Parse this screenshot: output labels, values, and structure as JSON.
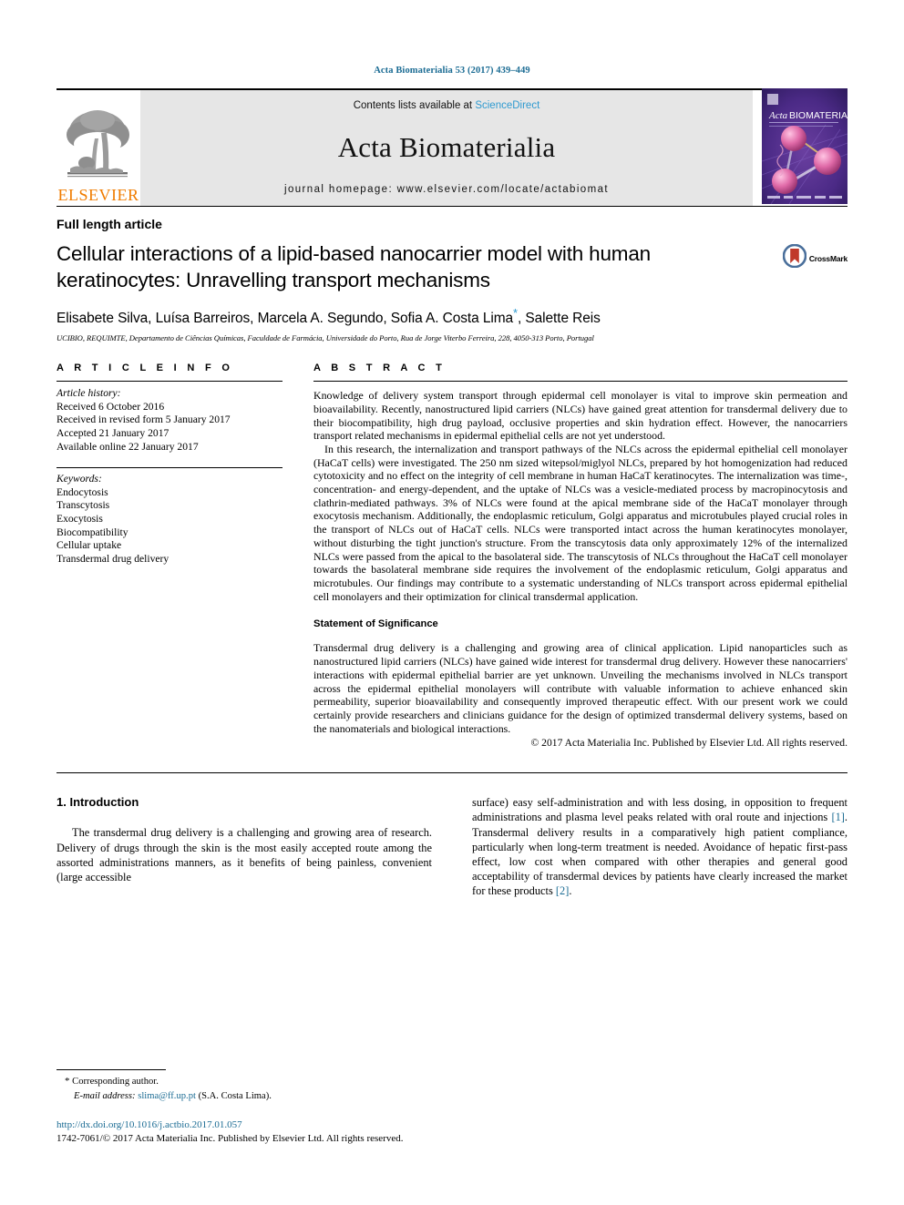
{
  "running_head": "Acta Biomaterialia 53 (2017) 439–449",
  "masthead": {
    "contents_prefix": "Contents lists available at ",
    "sciencedirect": "ScienceDirect",
    "journal_title": "Acta Biomaterialia",
    "homepage": "journal homepage: www.elsevier.com/locate/actabiomat",
    "publisher_wordmark": "ELSEVIER",
    "publisher_logo_icon": "elsevier-tree-icon",
    "cover_icon": "journal-cover-thumbnail",
    "cover_title": "Acta BIOMATERIALIA",
    "colors": {
      "band_bg": "#e6e6e6",
      "link": "#2e9ad0",
      "elsevier_orange": "#f07c00",
      "running_head": "#1a6b93"
    }
  },
  "article": {
    "type": "Full length article",
    "title": "Cellular interactions of a lipid-based nanocarrier model with human keratinocytes: Unravelling transport mechanisms",
    "crossmark": {
      "label": "CrossMark",
      "icon": "crossmark-icon"
    },
    "authors": "Elisabete Silva, Luísa Barreiros, Marcela A. Segundo, Sofia A. Costa Lima",
    "authors_tail": ", Salette Reis",
    "corresponding_marker": "*",
    "affiliation": "UCIBIO, REQUIMTE, Departamento de Ciências Químicas, Faculdade de Farmácia, Universidade do Porto, Rua de Jorge Viterbo Ferreira, 228, 4050-313 Porto, Portugal"
  },
  "article_info": {
    "heading": "A R T I C L E   I N F O",
    "history_label": "Article history:",
    "history": [
      "Received 6 October 2016",
      "Received in revised form 5 January 2017",
      "Accepted 21 January 2017",
      "Available online 22 January 2017"
    ],
    "keywords_label": "Keywords:",
    "keywords": [
      "Endocytosis",
      "Transcytosis",
      "Exocytosis",
      "Biocompatibility",
      "Cellular uptake",
      "Transdermal drug delivery"
    ]
  },
  "abstract": {
    "heading": "A B S T R A C T",
    "paragraphs": [
      "Knowledge of delivery system transport through epidermal cell monolayer is vital to improve skin permeation and bioavailability. Recently, nanostructured lipid carriers (NLCs) have gained great attention for transdermal delivery due to their biocompatibility, high drug payload, occlusive properties and skin hydration effect. However, the nanocarriers transport related mechanisms in epidermal epithelial cells are not yet understood.",
      "In this research, the internalization and transport pathways of the NLCs across the epidermal epithelial cell monolayer (HaCaT cells) were investigated. The 250 nm sized witepsol/miglyol NLCs, prepared by hot homogenization had reduced cytotoxicity and no effect on the integrity of cell membrane in human HaCaT keratinocytes. The internalization was time-, concentration- and energy-dependent, and the uptake of NLCs was a vesicle-mediated process by macropinocytosis and clathrin-mediated pathways. 3% of NLCs were found at the apical membrane side of the HaCaT monolayer through exocytosis mechanism. Additionally, the endoplasmic reticulum, Golgi apparatus and microtubules played crucial roles in the transport of NLCs out of HaCaT cells. NLCs were transported intact across the human keratinocytes monolayer, without disturbing the tight junction's structure. From the transcytosis data only approximately 12% of the internalized NLCs were passed from the apical to the basolateral side. The transcytosis of NLCs throughout the HaCaT cell monolayer towards the basolateral membrane side requires the involvement of the endoplasmic reticulum, Golgi apparatus and microtubules. Our findings may contribute to a systematic understanding of NLCs transport across epidermal epithelial cell monolayers and their optimization for clinical transdermal application."
    ],
    "statement_heading": "Statement of Significance",
    "statement_body": "Transdermal drug delivery is a challenging and growing area of clinical application. Lipid nanoparticles such as nanostructured lipid carriers (NLCs) have gained wide interest for transdermal drug delivery. However these nanocarriers' interactions with epidermal epithelial barrier are yet unknown. Unveiling the mechanisms involved in NLCs transport across the epidermal epithelial monolayers will contribute with valuable information to achieve enhanced skin permeability, superior bioavailability and consequently improved therapeutic effect. With our present work we could certainly provide researchers and clinicians guidance for the design of optimized transdermal delivery systems, based on the nanomaterials and biological interactions.",
    "copyright": "© 2017 Acta Materialia Inc. Published by Elsevier Ltd. All rights reserved."
  },
  "introduction": {
    "section_title": "1. Introduction",
    "left_paragraph": "The transdermal drug delivery is a challenging and growing area of research. Delivery of drugs through the skin is the most easily accepted route among the assorted administrations manners, as it benefits of being painless, convenient (large accessible",
    "right_part1": "surface) easy self-administration and with less dosing, in opposition to frequent administrations and plasma level peaks related with oral route and injections ",
    "right_ref1": "[1]",
    "right_part2": ". Transdermal delivery results in a comparatively high patient compliance, particularly when long-term treatment is needed. Avoidance of hepatic first-pass effect, low cost when compared with other therapies and general good acceptability of transdermal devices by patients have clearly increased the market for these products ",
    "right_ref2": "[2]",
    "right_part3": "."
  },
  "footnotes": {
    "corresponding_marker": "*",
    "corresponding_text": "Corresponding author.",
    "email_label": "E-mail address:",
    "email": "slima@ff.up.pt",
    "email_owner": "(S.A. Costa Lima).",
    "doi": "http://dx.doi.org/10.1016/j.actbio.2017.01.057",
    "issn_line": "1742-7061/© 2017 Acta Materialia Inc. Published by Elsevier Ltd. All rights reserved."
  }
}
